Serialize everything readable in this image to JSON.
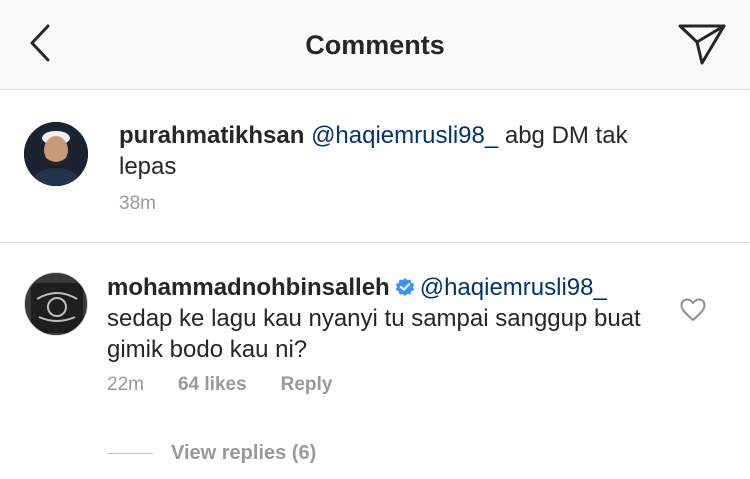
{
  "header": {
    "title": "Comments",
    "back_icon": "chevron-left-icon",
    "send_icon": "paper-plane-icon"
  },
  "comments": [
    {
      "username": "purahmatikhsan",
      "mention": "@haqiemrusli98_",
      "text": "  abg DM tak lepas",
      "time": "38m"
    },
    {
      "username": "mohammadnohbinsalleh",
      "verified": true,
      "mention": "@haqiemrusli98_",
      "text": " sedap ke lagu kau nyanyi tu sampai sanggup buat gimik bodo kau ni?",
      "time": "22m",
      "likes": "64 likes",
      "reply_label": "Reply",
      "view_replies": "View replies (6)"
    }
  ],
  "colors": {
    "mention": "#003569",
    "meta": "#999999",
    "verified": "#3897f0"
  }
}
